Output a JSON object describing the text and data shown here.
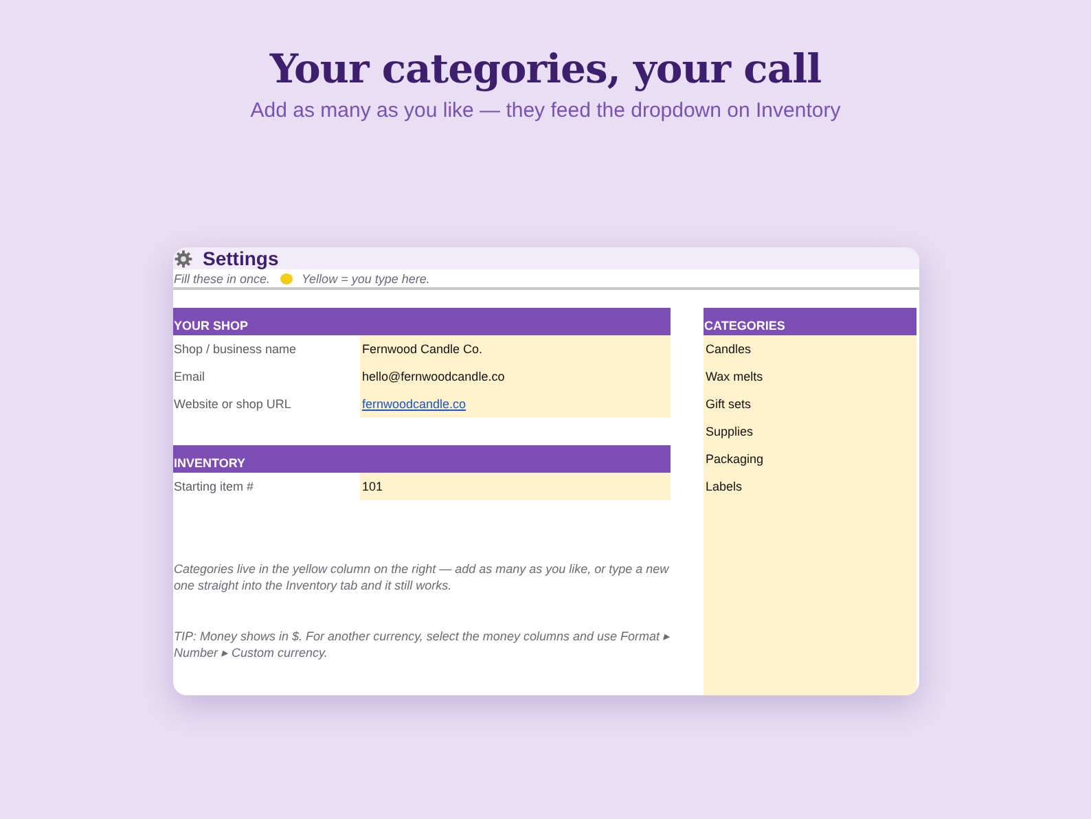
{
  "heading": {
    "title": "Your categories, your call",
    "subtitle": "Add as many as you like — they feed the dropdown on Inventory"
  },
  "sheet": {
    "title": "Settings",
    "note_before": "Fill these in once.",
    "note_after": "Yellow = you type here.",
    "sections": [
      {
        "title": "YOUR SHOP",
        "rows": [
          {
            "label": "Shop / business name",
            "value": "Fernwood Candle Co.",
            "kind": "text"
          },
          {
            "label": "Email",
            "value": "hello@fernwoodcandle.co",
            "kind": "text"
          },
          {
            "label": "Website or shop URL",
            "value": "fernwoodcandle.co",
            "kind": "link"
          }
        ]
      },
      {
        "title": "INVENTORY",
        "rows": [
          {
            "label": "Starting item #",
            "value": "101",
            "kind": "text"
          }
        ]
      }
    ],
    "notes": [
      "Categories live in the yellow column on the right — add as many as you like, or type a new one straight into the Inventory tab and it still works.",
      "TIP: Money shows in $. For another currency, select the money columns and use Format ▸ Number ▸ Custom currency."
    ],
    "categories": {
      "title": "CATEGORIES",
      "items": [
        "Candles",
        "Wax melts",
        "Gift sets",
        "Supplies",
        "Packaging",
        "Labels"
      ]
    }
  }
}
